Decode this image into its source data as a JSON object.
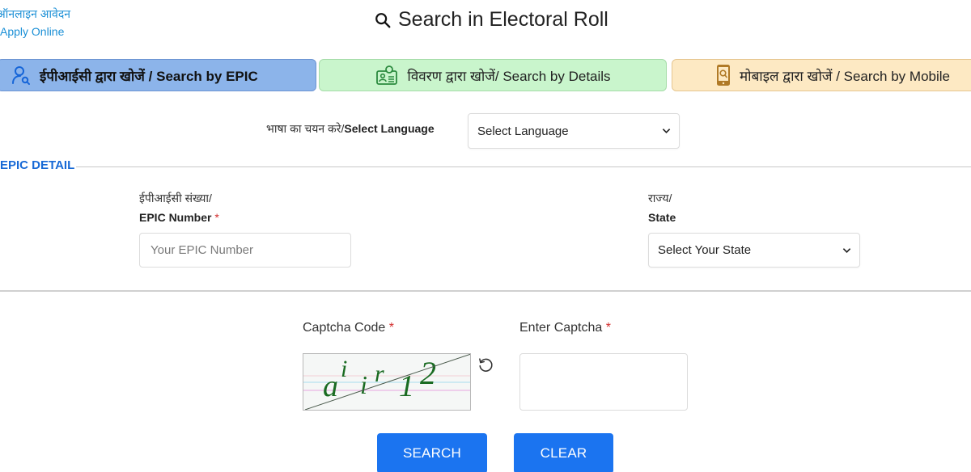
{
  "header": {
    "apply_online_hindi": "ऑनलाइन आवेदन",
    "apply_online_english": "Apply Online",
    "title": "Search in Electoral Roll",
    "title_icon": "search-icon"
  },
  "tabs": [
    {
      "label_hindi": "ईपीआईसी द्वारा खोजें / ",
      "label_english": "Search by EPIC",
      "icon": "user-search-icon",
      "active": true,
      "color": "#8cb4ea"
    },
    {
      "label_hindi": "विवरण द्वारा खोजें/ ",
      "label_english": "Search by Details",
      "icon": "id-card-search-icon",
      "active": false,
      "color": "#c9f5cc"
    },
    {
      "label_hindi": "मोबाइल द्वारा खोजें / ",
      "label_english": "Search by Mobile",
      "icon": "mobile-search-icon",
      "active": false,
      "color": "#fde9c3"
    }
  ],
  "language": {
    "label_hindi": "भाषा का चयन करे/",
    "label_english": "Select Language",
    "selected": "Select Language"
  },
  "section": {
    "title": "EPIC DETAIL"
  },
  "epic_field": {
    "label_hindi": "ईपीआईसी संख्या/",
    "label_english": "EPIC Number",
    "required_mark": "*",
    "value": "",
    "placeholder": "Your EPIC Number"
  },
  "state_field": {
    "label_hindi": "राज्य/",
    "label_english": "State",
    "selected": "Select Your State"
  },
  "captcha": {
    "code_label": "Captcha Code",
    "enter_label": "Enter Captcha",
    "required_mark": "*",
    "image_text_parts": [
      "a",
      "i",
      "i",
      "r",
      "1",
      "2"
    ],
    "input_value": ""
  },
  "buttons": {
    "search": "SEARCH",
    "clear": "CLEAR"
  },
  "colors": {
    "accent": "#1b74f0",
    "section_title": "#1769d6",
    "link": "#1a8fd6",
    "required": "#d32f2f"
  }
}
